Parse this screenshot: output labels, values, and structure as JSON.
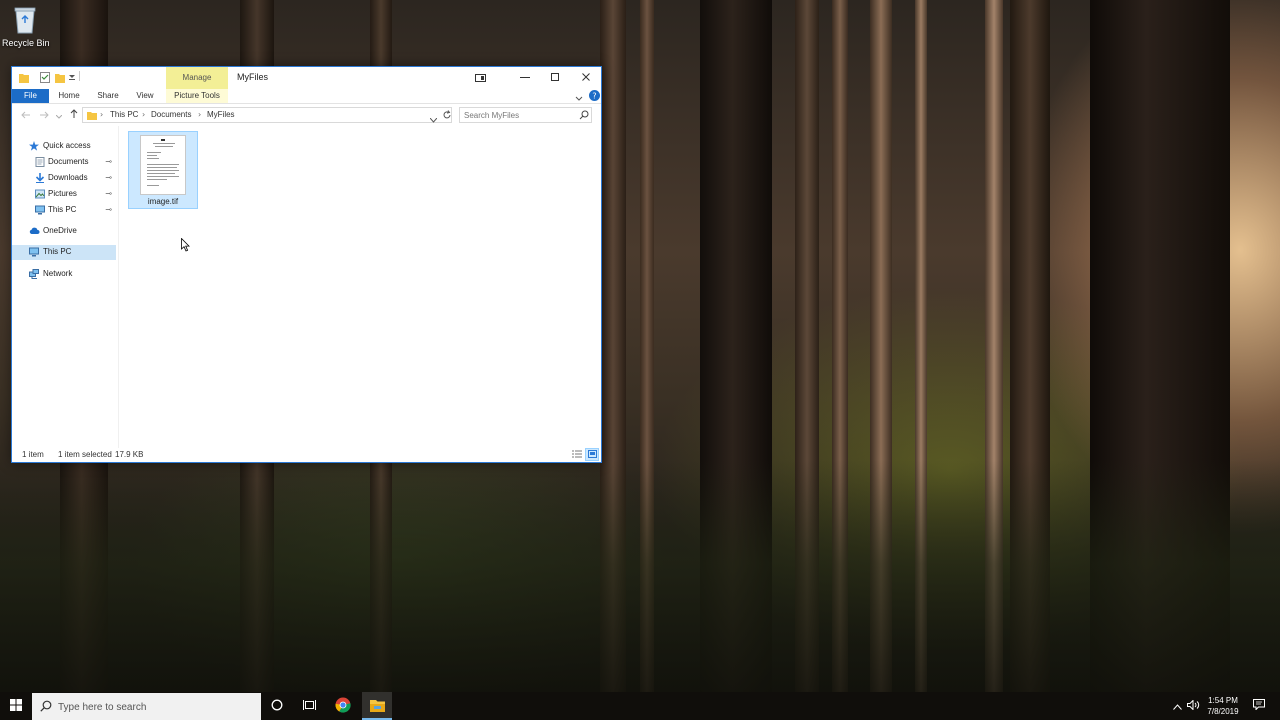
{
  "desktop": {
    "recycle_bin_label": "Recycle Bin"
  },
  "window": {
    "title": "MyFiles",
    "contextual_tab_group": "Manage",
    "contextual_tab_label": "Picture Tools",
    "ribbon_tabs": [
      {
        "label": "File"
      },
      {
        "label": "Home"
      },
      {
        "label": "Share"
      },
      {
        "label": "View"
      }
    ],
    "address": {
      "crumbs": [
        "This PC",
        "Documents",
        "MyFiles"
      ]
    },
    "search": {
      "placeholder": "Search MyFiles"
    },
    "nav_pane": {
      "items": [
        {
          "label": "Quick access",
          "icon": "star-icon"
        },
        {
          "label": "Documents",
          "icon": "documents-icon",
          "pinned": true
        },
        {
          "label": "Downloads",
          "icon": "download-icon",
          "pinned": true
        },
        {
          "label": "Pictures",
          "icon": "pictures-icon",
          "pinned": true
        },
        {
          "label": "This PC",
          "icon": "computer-icon",
          "pinned": true
        },
        {
          "label": "OneDrive",
          "icon": "cloud-icon"
        },
        {
          "label": "This PC",
          "icon": "computer-icon",
          "selected": true
        },
        {
          "label": "Network",
          "icon": "network-icon"
        }
      ]
    },
    "files": [
      {
        "name": "image.tif",
        "selected": true
      }
    ],
    "status": {
      "item_count": "1 item",
      "selection": "1 item selected",
      "size": "17.9 KB"
    }
  },
  "taskbar": {
    "search_placeholder": "Type here to search",
    "time": "1:54 PM",
    "date": "7/8/2019"
  },
  "colors": {
    "accent": "#1c6cc7",
    "selection": "#cce8ff",
    "manage_tab": "#f3ef96"
  }
}
